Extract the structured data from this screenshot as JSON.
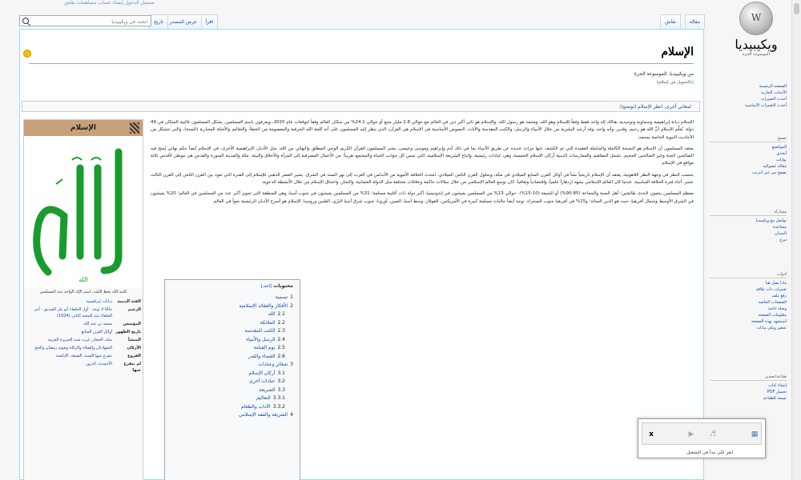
{
  "topbar": {
    "links": "تسجيل الدخول  إنشاء حساب  مساهمات  نقاش"
  },
  "logo": {
    "name": "ويكيبيديا",
    "slogan": "الموسوعة الحرة",
    "glyph": "W"
  },
  "sidebar": {
    "nav": [
      "الصفحة الرئيسية",
      "الأحداث الجارية",
      "أحدث التغييرات",
      "أحدث التغييرات الأساسية"
    ],
    "explore_title": "تصفح",
    "explore": [
      "المواضيع",
      "أبجدي",
      "بوابات",
      "مقالة عشوائية",
      "تصفح من غير انترنت"
    ],
    "contribute_title": "مشاركة",
    "contribute": [
      "تواصل مع ويكيبيديا",
      "مساعدة",
      "الميدان",
      "تبرع"
    ],
    "tools_title": "أدوات",
    "tools": [
      "ماذا يصل هنا",
      "تغييرات ذات علاقة",
      "رفع ملف",
      "الصفحات الخاصة",
      "وصلة دائمة",
      "معلومات الصفحة",
      "استشهد بهذه الصفحة",
      "عنصر ويكي بيانات"
    ],
    "print_title": "طباعة/تصدير",
    "print": [
      "إنشاء كتاب",
      "تحميل PDF",
      "نسخة للطباعة"
    ]
  },
  "tabs": {
    "article": "مقالة",
    "talk": "نقاش",
    "read": "اقرأ",
    "view_source": "عرض المصدر",
    "history": "تاريخ"
  },
  "search": {
    "placeholder": "ابحث في ويكيبيديا"
  },
  "page": {
    "title": "الإسلام",
    "from": "من ويكيبيديا، الموسوعة الحرة",
    "redirect": "(بالتحويل من إسلام)",
    "hatnote": "لمعاني أخرى، انظر الإسلام (توضيح)."
  },
  "infobox": {
    "title": "الإسلام",
    "calligraphy": "الله",
    "caption": "كلمة الله بخط الثلث، اسم الإله الواحد عند المسلمين",
    "rows": [
      {
        "k": "الفئة الدينية",
        "v": "ديانات إبراهيمية"
      },
      {
        "k": "الزعيم",
        "v": "حاليًا لا يوجد · أول الخلفاء أبو بكر الصديق · آخر الخلفاء عبد المجيد الثاني (1924)"
      },
      {
        "k": "المؤسس",
        "v": "محمد بن عبد الله"
      },
      {
        "k": "تاريخ الظهور",
        "v": "أوائل القرن السابع"
      },
      {
        "k": "المنشأ",
        "v": "مكة، الحجاز، غرب شبه الجزيرة العربية"
      },
      {
        "k": "الأركان",
        "v": "الشهادتان والصلاة والزكاة وصوم رمضان والحج"
      },
      {
        "k": "الفروع",
        "v": "تتفرع عنها السنة، الشيعة، الإباضية"
      },
      {
        "k": "لم تتفرع عنها",
        "v": "الأحمدية، الدروز"
      }
    ]
  },
  "article": {
    "p1": "الإسلام ديانة إبراهيمية وسماوية وتوحيدية، هنالك إله واحد فقط وفقاً للإسلام وهو الله، ومحمد هو رسول الله. والإسلام هو ثاني أكبر دين في العالم مع حوالي 1.8 مليار متبع أو حوالي 24.1% من سكان العالم وفقاً لتوقعات عام 2020، ويعرفون باسم المسلمين. يشكل المسلمون غالبية السكان في 49 دولة. يُعلِّم الإسلام أنَّ الله هو رحيم، وقدير، وأنه واحد، وقد أرشد البشرية من خلال الأنبياء والرسل، والكتب المقدسة والآيات. النصوص الأساسية في الإسلام هي القرآن، الذي ينظر إليه المسلمون على أنه كلمة الله الحرفية والمعصومة من الخطأ، والتعاليم والأمثلة المعيارية (السنة)، والتي تتشكل من الأحاديث النبوية الخاصة بمحمد.",
    "p2": "يعتقد المسلمون أن الإسلام هو النسخة الكاملة والشاملة للعقيدة التي تم الكشف عنها مرات عديدة عن طريق الأنبياء بما في ذلك آدم وإبراهيم وموسى وعيسى. يعتبر المسلمون القرآن الكريم الوحي المطلق والنهائي من الله. مثل الأديان الإبراهيمية الأخرى، في الإسلام أيضاً حكم نهائي يُمنح فيه الصالحين الجنة وغير الصالحين الجحيم. تشمل المفاهيم والممارسات الدينية أركان الإسلام الخمسة، وهي عبادات رئيسية، واتباع الشريعة الإسلامية، التي تمس كل جوانب الحياة والمجتمع تقريباً؛ من الأعمال المصرفية إلى المرأة والأخلاق والبيئة. مكة والمدينة المنورة والقدس هي موطن لأقدس ثلاثة مواقع في الإسلام.",
    "p3": "بحسب النظر في وجهة النظر اللاهوتية، يعتقد أن الإسلام تاريخياً نشأ في أوائل القرن السابع الميلادي في مكة، وبحلول القرن الثامن الميلادي، امتدت الخلافة الأموية من الأندلس في الغرب إلى نهر السند في الشرق. يشير العصر الذهبي للإسلام إلى الفترة التي تعود بين القرن الثامن إلى القرن الثالث عشر، أثناء فترة الخلافة العباسية، عندما كان العالم الإسلامي يشهد ازدهاراً علمياً، واقتصادياً وثقافياً. كان توسع العالم الإسلامي من خلال سلالات حاكمة وخلافات مختلفة مثل الدولة العثمانية، والتجار، واعتناق الإسلام من خلال الأنشطة الدعوية.",
    "p4": "معظم المسلمين ينتمون لإحدى طائفتين؛ أهل السنة والجماعة (85-90%) أو الشيعة (10-15%). حوالي 13% من المسلمين يعيشون في إندونيسيا، أكبر دولة ذات أغلبية مسلمة؛ 31% من المسلمين يعيشون في جنوب آسيا، وهي المنطقة التي تحوي أكبر عدد من المسلمين في العالم؛ 20% يعيشون في الشرق الأوسط وشمال أفريقيا، حيث هو الدين السائد؛ و15% في أفريقيا جنوب الصحراء. توجد أيضاً جاليات مسلمة كبيرة في الأمريكتين، القوقاز، وسط آسيا، الصين، أوروبا، جنوب شرق آسيا البرّي، الفلبين وروسيا. الإسلام هو أسرع الأديان الرئيسية نمواً في العالم."
  },
  "toc": {
    "title": "محتويات",
    "toggle": "[أخف]",
    "items": [
      {
        "n": "1",
        "t": "تسمية",
        "sub": false
      },
      {
        "n": "2",
        "t": "الأفكار والعقائد الإسلامية",
        "sub": false
      },
      {
        "n": "2.1",
        "t": "الله",
        "sub": true
      },
      {
        "n": "2.2",
        "t": "الملائكة",
        "sub": true
      },
      {
        "n": "2.3",
        "t": "الكتب المقدسة",
        "sub": true
      },
      {
        "n": "2.4",
        "t": "الرسل والأنبياء",
        "sub": true
      },
      {
        "n": "2.5",
        "t": "يوم القيامة",
        "sub": true
      },
      {
        "n": "2.6",
        "t": "القضاء والقدر",
        "sub": true
      },
      {
        "n": "3",
        "t": "شعائر وعبادات",
        "sub": false
      },
      {
        "n": "3.1",
        "t": "أركان الإسلام",
        "sub": true
      },
      {
        "n": "3.2",
        "t": "عبادات أخرى",
        "sub": true
      },
      {
        "n": "3.3",
        "t": "الشريعة",
        "sub": true
      },
      {
        "n": "3.3.1",
        "t": "التعاليم",
        "sub": true
      },
      {
        "n": "3.3.2",
        "t": "الآداب والطعام",
        "sub": true
      },
      {
        "n": "4",
        "t": "الشريعة والفقه الإسلامي",
        "sub": false
      }
    ]
  },
  "popup": {
    "hint": "انقر لكي تبدأ في التشغيل",
    "close": "x"
  }
}
